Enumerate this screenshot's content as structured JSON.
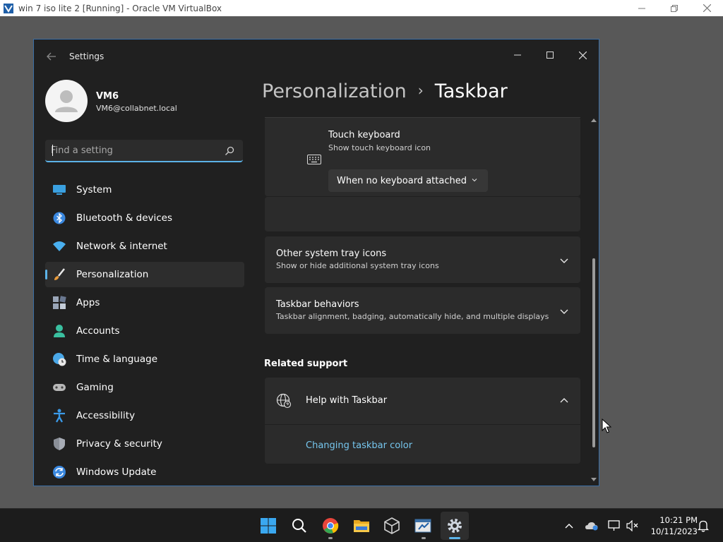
{
  "host": {
    "window_title": "win 7 iso lite 2 [Running] - Oracle VM VirtualBox"
  },
  "app": {
    "title": "Settings"
  },
  "user": {
    "name": "VM6",
    "email": "VM6@collabnet.local"
  },
  "search": {
    "placeholder": "Find a setting"
  },
  "sidebar": {
    "items": [
      {
        "label": "System",
        "icon": "monitor-icon",
        "active": false
      },
      {
        "label": "Bluetooth & devices",
        "icon": "bluetooth-icon",
        "active": false
      },
      {
        "label": "Network & internet",
        "icon": "wifi-icon",
        "active": false
      },
      {
        "label": "Personalization",
        "icon": "paintbrush-icon",
        "active": true
      },
      {
        "label": "Apps",
        "icon": "apps-icon",
        "active": false
      },
      {
        "label": "Accounts",
        "icon": "person-icon",
        "active": false
      },
      {
        "label": "Time & language",
        "icon": "globe-clock-icon",
        "active": false
      },
      {
        "label": "Gaming",
        "icon": "gamepad-icon",
        "active": false
      },
      {
        "label": "Accessibility",
        "icon": "accessibility-icon",
        "active": false
      },
      {
        "label": "Privacy & security",
        "icon": "shield-icon",
        "active": false
      },
      {
        "label": "Windows Update",
        "icon": "update-icon",
        "active": false
      }
    ]
  },
  "breadcrumb": {
    "parent": "Personalization",
    "separator": "›",
    "current": "Taskbar"
  },
  "touch_keyboard": {
    "title": "Touch keyboard",
    "subtitle": "Show touch keyboard icon",
    "selected": "When no keyboard attached"
  },
  "other_tray": {
    "title": "Other system tray icons",
    "subtitle": "Show or hide additional system tray icons"
  },
  "behaviors": {
    "title": "Taskbar behaviors",
    "subtitle": "Taskbar alignment, badging, automatically hide, and multiple displays"
  },
  "related": {
    "heading": "Related support",
    "help_title": "Help with Taskbar",
    "link": "Changing taskbar color"
  },
  "taskbar": {
    "apps": [
      "start-icon",
      "search-icon",
      "chrome-icon",
      "file-explorer-icon",
      "virtualbox-icon",
      "network-tool-icon",
      "settings-icon"
    ],
    "time": "10:21 PM",
    "date": "10/11/2023"
  },
  "colors": {
    "accent": "#5cb3e8",
    "link": "#76c6ee",
    "window_bg": "#202020",
    "card_bg": "#2b2b2b"
  }
}
